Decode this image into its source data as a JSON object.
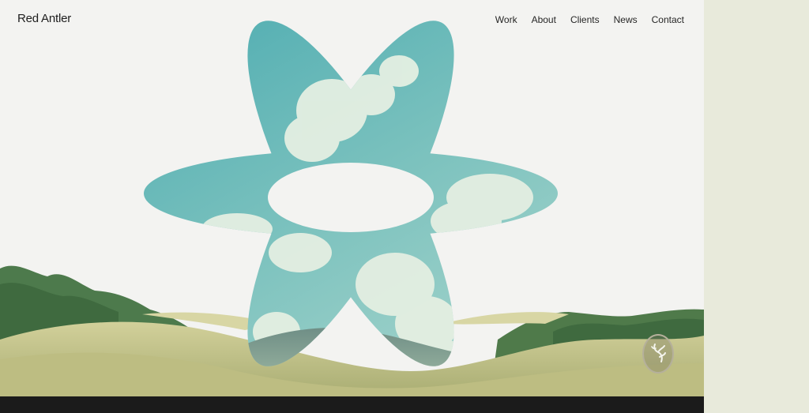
{
  "brand": {
    "name": "Red Antler"
  },
  "nav": {
    "items": [
      {
        "label": "Work"
      },
      {
        "label": "About"
      },
      {
        "label": "Clients"
      },
      {
        "label": "News"
      },
      {
        "label": "Contact"
      }
    ]
  },
  "hero": {
    "shape_icon": "flower-star-icon",
    "badge_icon": "antler-icon"
  },
  "colors": {
    "background": "#f3f3f1",
    "sky_teal": "#5fb3b3",
    "hills": "#c9c98a",
    "trees": "#4f7a4a",
    "gutter": "#e8eadb",
    "footer": "#1b1b1b"
  }
}
